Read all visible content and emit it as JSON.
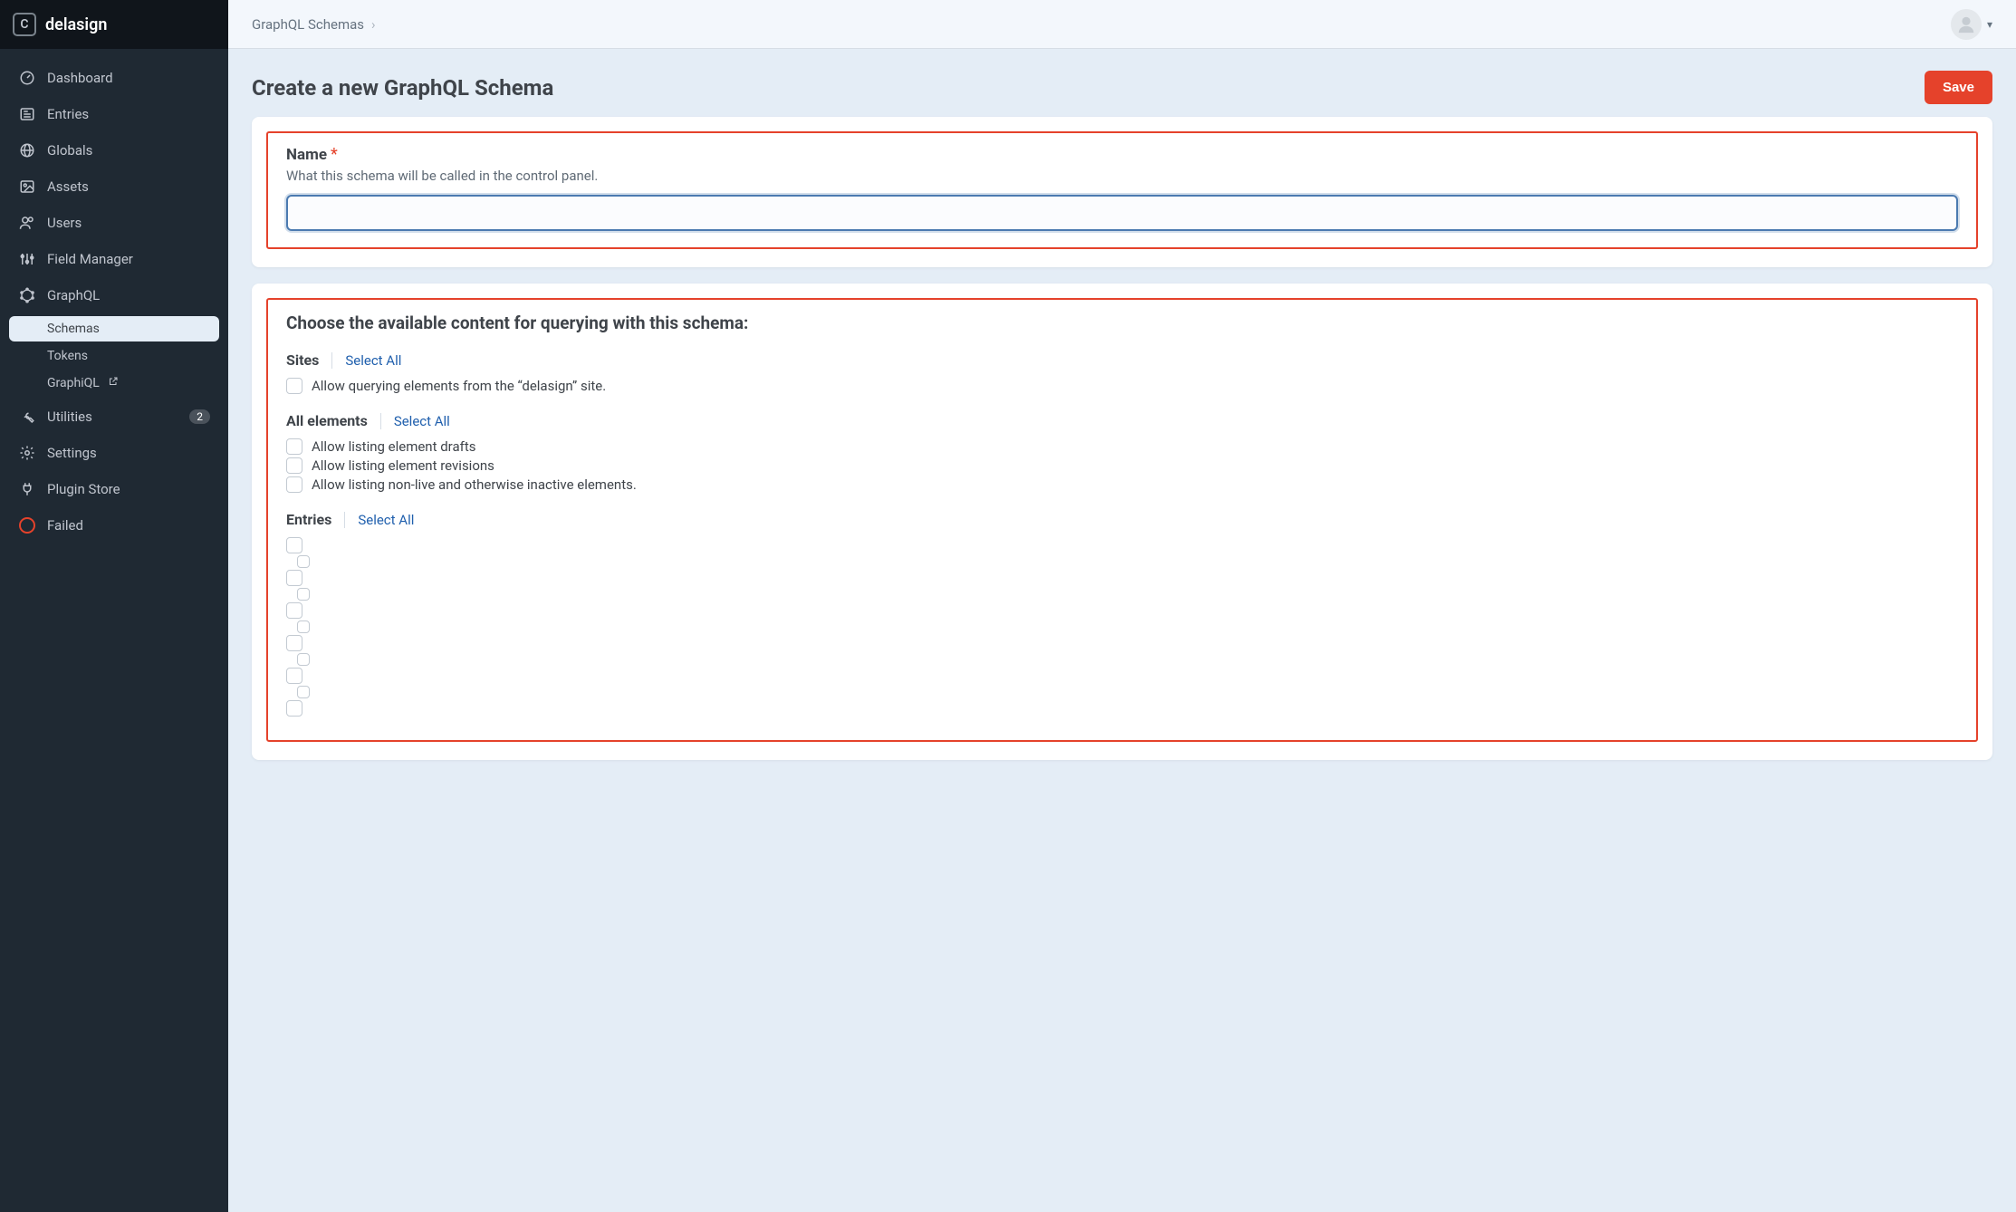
{
  "brand": {
    "initial": "C",
    "name": "delasign"
  },
  "sidebar": {
    "items": [
      {
        "label": "Dashboard"
      },
      {
        "label": "Entries"
      },
      {
        "label": "Globals"
      },
      {
        "label": "Assets"
      },
      {
        "label": "Users"
      },
      {
        "label": "Field Manager"
      },
      {
        "label": "GraphQL"
      },
      {
        "label": "Utilities",
        "badge": "2"
      },
      {
        "label": "Settings"
      },
      {
        "label": "Plugin Store"
      },
      {
        "label": "Failed"
      }
    ],
    "graphql_sub": [
      {
        "label": "Schemas"
      },
      {
        "label": "Tokens"
      },
      {
        "label": "GraphiQL"
      }
    ]
  },
  "breadcrumb": {
    "item": "GraphQL Schemas"
  },
  "page": {
    "title": "Create a new GraphQL Schema",
    "save": "Save"
  },
  "name_field": {
    "label": "Name",
    "help": "What this schema will be called in the control panel.",
    "value": ""
  },
  "schema_section": {
    "title": "Choose the available content for querying with this schema:",
    "select_all": "Select All",
    "sites": {
      "title": "Sites",
      "items": [
        "Allow querying elements from the “delasign” site."
      ]
    },
    "all_elements": {
      "title": "All elements",
      "items": [
        "Allow listing element drafts",
        "Allow listing element revisions",
        "Allow listing non-live and otherwise inactive elements."
      ]
    },
    "entries": {
      "title": "Entries",
      "items": [
        "",
        "",
        "",
        "",
        "",
        "",
        "",
        "",
        "",
        "",
        ""
      ]
    }
  }
}
